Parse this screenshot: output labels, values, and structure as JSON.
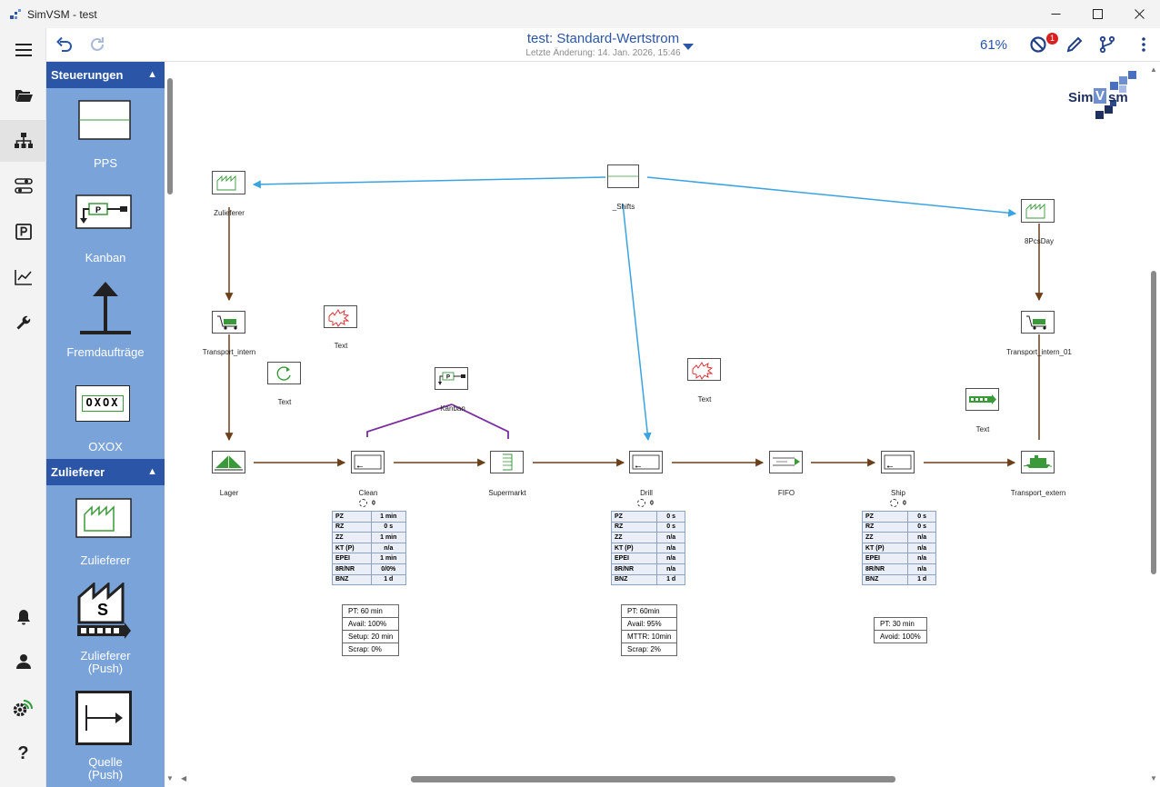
{
  "window": {
    "title": "SimVSM - test",
    "controls": [
      "minimize",
      "maximize",
      "close"
    ]
  },
  "toolbar": {
    "doc_title": "test: Standard-Wertstrom",
    "last_change": "Letzte Änderung: 14. Jan. 2026, 15:46",
    "zoom": "61%",
    "notification_count": "1",
    "icons": [
      "undo-icon",
      "redo-icon",
      "dropdown-icon",
      "block-icon",
      "pencil-icon",
      "branch-icon",
      "more-icon"
    ]
  },
  "rail": {
    "icons": [
      "menu-icon",
      "folder-icon",
      "hierarchy-icon",
      "settings-sliders-icon",
      "parking-icon",
      "chart-icon",
      "wrench-icon",
      "bell-icon",
      "user-icon",
      "gear-wifi-icon",
      "help-icon"
    ],
    "help": "?"
  },
  "palette": {
    "sections": [
      {
        "title": "Steuerungen",
        "items": [
          {
            "label": "PPS",
            "icon": "pps-icon"
          },
          {
            "label": "Kanban",
            "icon": "kanban-icon"
          },
          {
            "label": "Fremdaufträge",
            "icon": "external-order-icon"
          },
          {
            "label": "OXOX",
            "icon": "oxox-icon",
            "icon_text": "OXOX"
          }
        ]
      },
      {
        "title": "Zulieferer",
        "items": [
          {
            "label": "Zulieferer",
            "icon": "factory-icon"
          },
          {
            "label_line1": "Zulieferer",
            "label_line2": "(Push)",
            "icon": "factory-push-icon",
            "icon_text": "S"
          },
          {
            "label_line1": "Quelle",
            "label_line2": "(Push)",
            "icon": "source-push-icon"
          }
        ]
      }
    ]
  },
  "canvas": {
    "logo": {
      "text_left": "Sim",
      "text_right": "sm",
      "text_mid": "V"
    },
    "nodes": {
      "zulieferer": "Zulieferer",
      "shifts": "_Shifts",
      "pcsday": "8PcsDay",
      "transport_intern": "Transport_intern",
      "transport_intern_01": "Transport_intern_01",
      "text1": "Text",
      "text2": "Text",
      "text3": "Text",
      "text4": "Text",
      "kanban": "Kanban",
      "kanban_p": "P",
      "lager": "Lager",
      "clean": "Clean",
      "supermarkt": "Supermarkt",
      "drill": "Drill",
      "fifo": "FIFO",
      "ship": "Ship",
      "transport_extern": "Transport_extern"
    },
    "counters": {
      "clean": "0",
      "drill": "0",
      "ship": "0"
    },
    "process_tables": {
      "clean": [
        [
          "PZ",
          "1 min"
        ],
        [
          "RZ",
          "0 s"
        ],
        [
          "ZZ",
          "1 min"
        ],
        [
          "KT (P)",
          "n/a"
        ],
        [
          "EPEI",
          "1 min"
        ],
        [
          "8R/NR",
          "0/0%"
        ],
        [
          "BNZ",
          "1 d"
        ]
      ],
      "drill": [
        [
          "PZ",
          "0 s"
        ],
        [
          "RZ",
          "0 s"
        ],
        [
          "ZZ",
          "n/a"
        ],
        [
          "KT (P)",
          "n/a"
        ],
        [
          "EPEI",
          "n/a"
        ],
        [
          "8R/NR",
          "n/a"
        ],
        [
          "BNZ",
          "1 d"
        ]
      ],
      "ship": [
        [
          "PZ",
          "0 s"
        ],
        [
          "RZ",
          "0 s"
        ],
        [
          "ZZ",
          "n/a"
        ],
        [
          "KT (P)",
          "n/a"
        ],
        [
          "EPEI",
          "n/a"
        ],
        [
          "8R/NR",
          "n/a"
        ],
        [
          "BNZ",
          "1 d"
        ]
      ]
    },
    "param_boxes": {
      "clean": [
        "PT: 60 min",
        "Avail: 100%",
        "Setup: 20 min",
        "Scrap: 0%"
      ],
      "drill": [
        "PT: 60min",
        "Avail: 95%",
        "MTTR: 10min",
        "Scrap: 2%"
      ],
      "ship": [
        "PT: 30 min",
        "Avoid: 100%"
      ]
    }
  },
  "colors": {
    "primary": "#2b55a7",
    "palette_bg": "#7aa3d9",
    "material_flow": "#6b3f1a",
    "info_flow": "#3aa3e0",
    "kanban_flow": "#7a2ea0",
    "green": "#3a9a3a",
    "badge": "#d92020"
  }
}
